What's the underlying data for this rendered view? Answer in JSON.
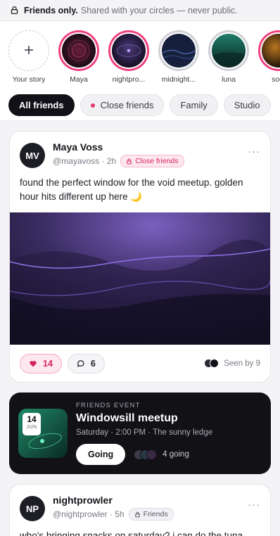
{
  "banner": {
    "strong": "Friends only.",
    "text": "Shared with your circles — never public."
  },
  "stories": [
    {
      "name": "Your story",
      "type": "add"
    },
    {
      "name": "Maya"
    },
    {
      "name": "nightpro..."
    },
    {
      "name": "midnight..."
    },
    {
      "name": "luna"
    },
    {
      "name": "soot"
    }
  ],
  "chips": [
    {
      "label": "All friends",
      "active": true
    },
    {
      "label": "Close friends"
    },
    {
      "label": "Family"
    },
    {
      "label": "Studio"
    }
  ],
  "post1": {
    "initials": "MV",
    "name": "Maya Voss",
    "handle": "@mayavoss · 2h",
    "tag": "Close friends",
    "text": "found the perfect window for the void meetup. golden hour hits different up here 🌙",
    "likes": "14",
    "comments": "6",
    "seen": "Seen by 9"
  },
  "event": {
    "day": "14",
    "month": "JUN",
    "kicker": "FRIENDS EVENT",
    "title": "Windowsill meetup",
    "when": "Saturday · 2:00 PM · The sunny ledge",
    "button": "Going",
    "count": "4 going"
  },
  "post2": {
    "initials": "NP",
    "name": "nightprowler",
    "handle": "@nightprowler · 5h",
    "tag": "Friends",
    "text": "who's bringing snacks on saturday? i can do the tuna"
  },
  "colors": {
    "accent_pink": "#e8336f",
    "dark": "#111116"
  }
}
